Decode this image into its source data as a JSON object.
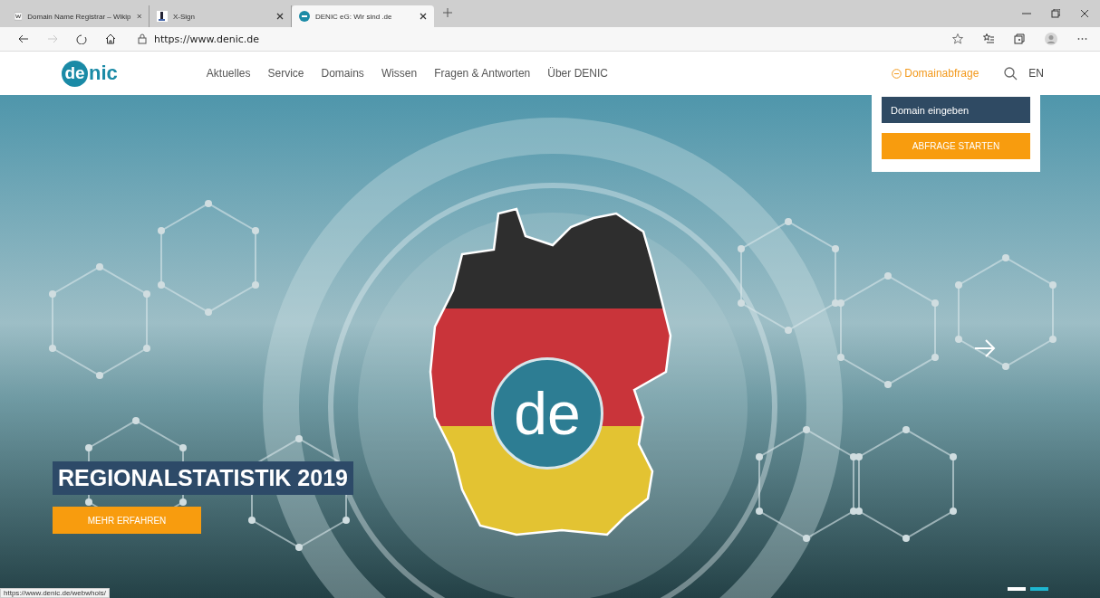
{
  "browser": {
    "tabs": [
      {
        "title": "Domain Name Registrar – Wikip",
        "kind": "wiki",
        "selected": false
      },
      {
        "title": "X-Sign",
        "kind": "document",
        "selected": false
      },
      {
        "title": "DENIC eG: Wir sind .de",
        "kind": "circle",
        "selected": true
      }
    ],
    "forward_disabled": true,
    "url": "https://www.denic.de",
    "status_url": "https://www.denic.de/webwhois/"
  },
  "header": {
    "logo": {
      "badge": "de",
      "text": "nic"
    },
    "nav": [
      "Aktuelles",
      "Service",
      "Domains",
      "Wissen",
      "Fragen & Antworten",
      "Über DENIC"
    ],
    "domain_query": "Domainabfrage",
    "language": "EN"
  },
  "domain_panel": {
    "placeholder": "Domain eingeben",
    "button": "ABFRAGE STARTEN"
  },
  "hero": {
    "badge": "de",
    "headline": "REGIONALSTATISTIK 2019",
    "button": "MEHR ERFAHREN",
    "slides": [
      {
        "selected": false
      },
      {
        "selected": true
      }
    ]
  }
}
